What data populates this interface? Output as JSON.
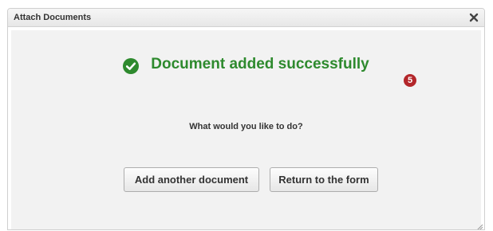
{
  "dialog": {
    "title": "Attach Documents",
    "close_icon": "close-icon"
  },
  "status": {
    "icon": "check-circle-icon",
    "message": "Document added successfully",
    "color": "#2e8a2e"
  },
  "step_badge": {
    "number": "5",
    "color": "#b3262a"
  },
  "question": "What would you like to do?",
  "buttons": {
    "add_another": "Add another document",
    "return_to_form": "Return to the form"
  }
}
